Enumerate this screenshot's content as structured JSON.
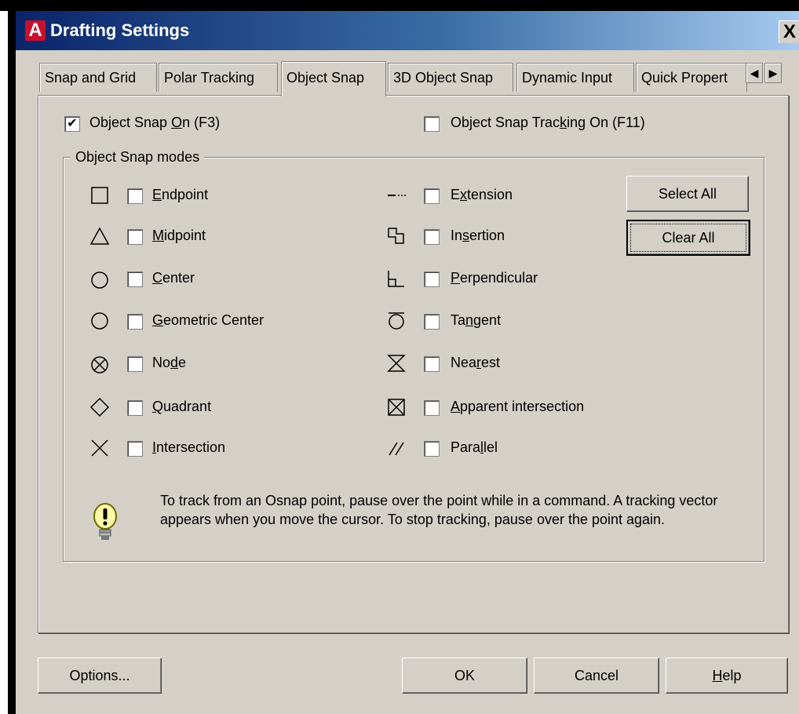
{
  "window": {
    "title": "Drafting Settings",
    "app_icon_letter": "A",
    "close_glyph": "X"
  },
  "tabs": [
    {
      "label": "Snap and Grid",
      "active": false
    },
    {
      "label": "Polar Tracking",
      "active": false
    },
    {
      "label": "Object Snap",
      "active": true
    },
    {
      "label": "3D Object Snap",
      "active": false
    },
    {
      "label": "Dynamic Input",
      "active": false
    },
    {
      "label": "Quick Propert",
      "active": false
    }
  ],
  "tab_scroll": {
    "left": "◀",
    "right": "▶"
  },
  "top_options": {
    "osnap_on": {
      "pre": "Object Snap ",
      "key": "O",
      "post": "n (F3)",
      "checked": true
    },
    "osnap_tracking": {
      "pre": "Object Snap Trac",
      "key": "k",
      "post": "ing On (F11)",
      "checked": false
    }
  },
  "group": {
    "title": "Object Snap modes",
    "left_modes": [
      {
        "pre": "",
        "key": "E",
        "post": "ndpoint",
        "checked": false,
        "icon": "endpoint-square-icon"
      },
      {
        "pre": "",
        "key": "M",
        "post": "idpoint",
        "checked": false,
        "icon": "midpoint-triangle-icon"
      },
      {
        "pre": "",
        "key": "C",
        "post": "enter",
        "checked": false,
        "icon": "center-circle-icon"
      },
      {
        "pre": "",
        "key": "G",
        "post": "eometric Center",
        "checked": false,
        "icon": "geometric-center-circle-icon"
      },
      {
        "pre": "No",
        "key": "d",
        "post": "e",
        "checked": false,
        "icon": "node-icon"
      },
      {
        "pre": "",
        "key": "Q",
        "post": "uadrant",
        "checked": false,
        "icon": "quadrant-diamond-icon"
      },
      {
        "pre": "",
        "key": "I",
        "post": "ntersection",
        "checked": false,
        "icon": "intersection-x-icon"
      }
    ],
    "right_modes": [
      {
        "pre": "E",
        "key": "x",
        "post": "tension",
        "checked": false,
        "icon": "extension-icon"
      },
      {
        "pre": "In",
        "key": "s",
        "post": "ertion",
        "checked": false,
        "icon": "insertion-icon"
      },
      {
        "pre": "",
        "key": "P",
        "post": "erpendicular",
        "checked": false,
        "icon": "perpendicular-icon"
      },
      {
        "pre": "Ta",
        "key": "n",
        "post": "gent",
        "checked": false,
        "icon": "tangent-icon"
      },
      {
        "pre": "Nea",
        "key": "r",
        "post": "est",
        "checked": false,
        "icon": "nearest-icon"
      },
      {
        "pre": "",
        "key": "A",
        "post": "pparent intersection",
        "checked": false,
        "icon": "apparent-intersection-icon"
      },
      {
        "pre": "Para",
        "key": "l",
        "post": "lel",
        "checked": false,
        "icon": "parallel-icon"
      }
    ],
    "select_all": "Select All",
    "clear_all": "Clear All",
    "tip": "To track from an Osnap point, pause over the point while in a command.  A tracking vector appears when you move the cursor.  To stop tracking, pause over the point again."
  },
  "footer": {
    "options": "Options...",
    "ok": "OK",
    "cancel": "Cancel",
    "help_key": "H",
    "help_rest": "elp"
  }
}
